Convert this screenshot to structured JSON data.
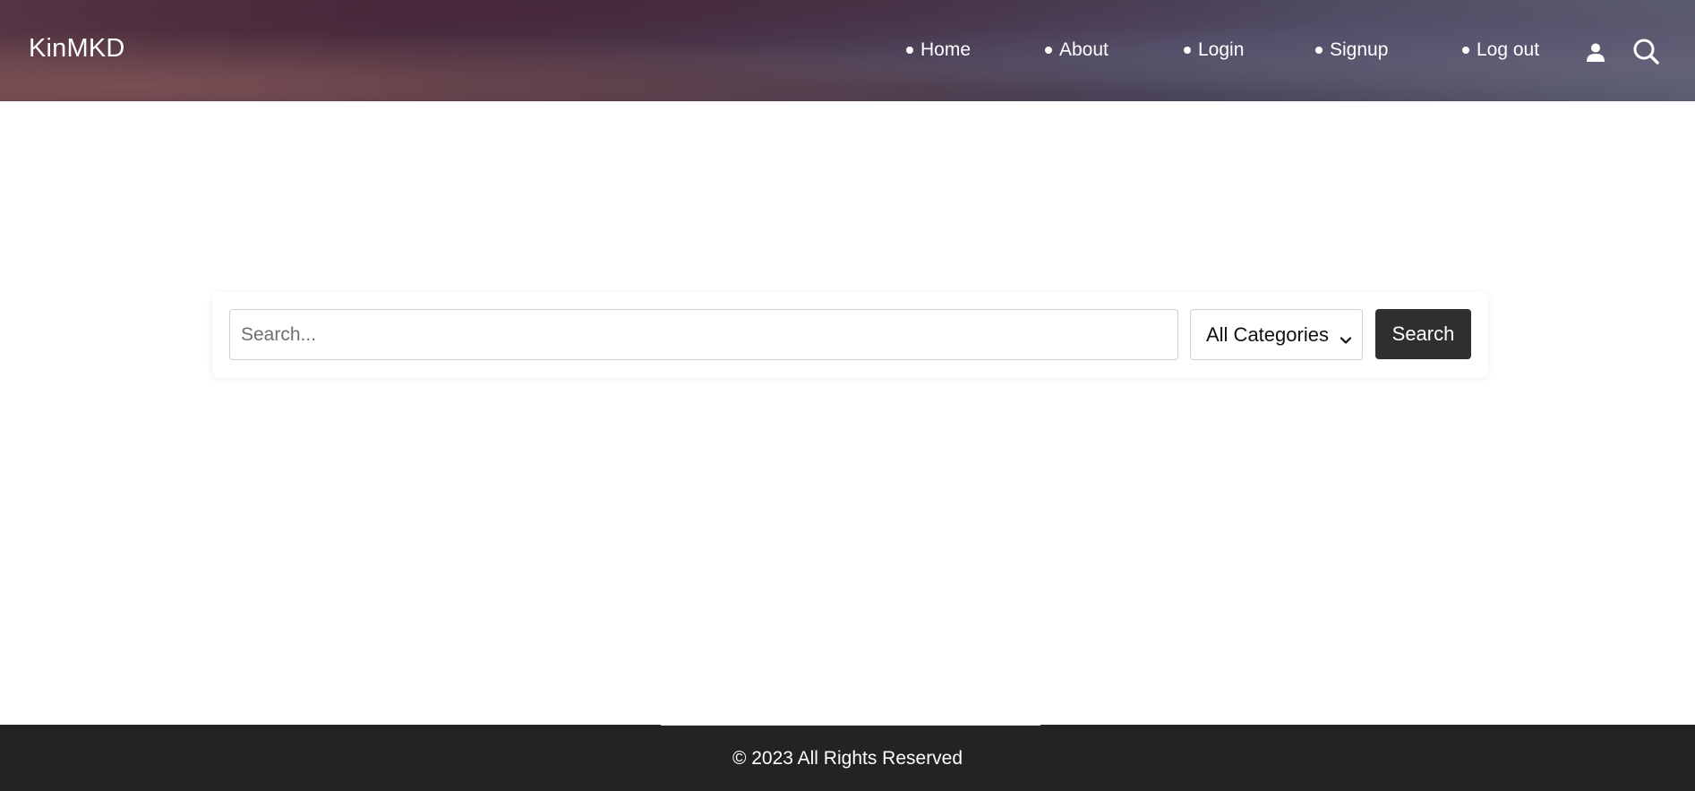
{
  "header": {
    "brand": "KinMKD",
    "nav": [
      {
        "label": "Home"
      },
      {
        "label": "About"
      },
      {
        "label": "Login"
      },
      {
        "label": "Signup"
      },
      {
        "label": "Log out"
      }
    ],
    "icons": [
      "user-icon",
      "search-icon"
    ]
  },
  "search": {
    "placeholder": "Search...",
    "value": "",
    "category_selected": "All Categories",
    "button_label": "Search"
  },
  "footer": {
    "text": "© 2023 All Rights Reserved"
  },
  "colors": {
    "button_bg": "#2f2f2f",
    "footer_bg": "#232323",
    "text_light": "#ffffff"
  }
}
